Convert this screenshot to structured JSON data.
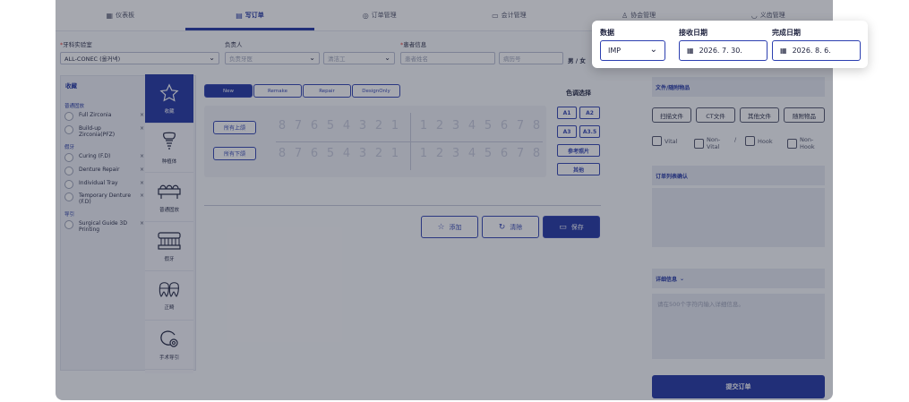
{
  "nav": {
    "items": [
      {
        "icon": "dashboard-icon",
        "label": "仪表板",
        "active": false
      },
      {
        "icon": "order-form-icon",
        "label": "写订单",
        "active": true
      },
      {
        "icon": "order-management-icon",
        "label": "订单管理",
        "active": false
      },
      {
        "icon": "accounting-icon",
        "label": "会计管理",
        "active": false
      },
      {
        "icon": "member-icon",
        "label": "协会管理",
        "active": false
      },
      {
        "icon": "denture-icon",
        "label": "义齿管理",
        "active": false
      }
    ]
  },
  "form": {
    "lab_label": "牙科实验室",
    "lab_value": "ALL-CONEC (올커넥)",
    "owner_label": "负责人",
    "owner_placeholder": "负责牙医",
    "tech_placeholder": "清洁工",
    "patient_label": "患者信息",
    "patient_name_placeholder": "患者姓名",
    "record_placeholder": "病历号",
    "gender_text": "男 / 女"
  },
  "favorites": {
    "title": "收藏",
    "categories": [
      "普通固放",
      "假牙",
      "导引"
    ],
    "items": [
      {
        "label": "Full Zirconia",
        "remove": "×"
      },
      {
        "label": "Build-up Zirconia(PFZ)",
        "remove": "×"
      },
      {
        "label": "Curing (F.D)",
        "remove": "×"
      },
      {
        "label": "Denture Repair",
        "remove": "×"
      },
      {
        "label": "Individual Tray",
        "remove": "×"
      },
      {
        "label": "Temporary Denture (F.D)",
        "remove": "×"
      },
      {
        "label": "Surgical Guide 3D Printing",
        "remove": "×"
      }
    ]
  },
  "categories": [
    {
      "icon": "star-icon",
      "label": "收藏"
    },
    {
      "icon": "implant-icon",
      "label": "种植体"
    },
    {
      "icon": "crown-bridge-icon",
      "label": "普通固放"
    },
    {
      "icon": "denture-icon",
      "label": "假牙"
    },
    {
      "icon": "ortho-icon",
      "label": "正畸"
    },
    {
      "icon": "surgical-guide-icon",
      "label": "手术导引"
    }
  ],
  "order_types": [
    "New",
    "Remake",
    "Repair",
    "DesignOnly"
  ],
  "teeth": {
    "upper_button": "所有上颌",
    "lower_button": "所有下颌",
    "left_numbers": [
      "8",
      "7",
      "6",
      "5",
      "4",
      "3",
      "2",
      "1"
    ],
    "right_numbers": [
      "1",
      "2",
      "3",
      "4",
      "5",
      "6",
      "7",
      "8"
    ]
  },
  "shade": {
    "title": "色调选择",
    "buttons": [
      "A1",
      "A2",
      "A3",
      "A3.5"
    ],
    "reference_photo": "参考照片",
    "other": "其他"
  },
  "actions": {
    "add": "添加",
    "clear": "清除",
    "save": "保存"
  },
  "right_panel": {
    "files_header": "文件/随附物品",
    "file_buttons": [
      "扫描文件",
      "CT文件",
      "其他文件",
      "随附物品"
    ],
    "checks": [
      "Vital",
      "Non-Vital",
      "Hook",
      "Non-Hook"
    ],
    "separator": "/",
    "order_list_header": "订单列表确认",
    "detail_header": "详细信息",
    "detail_placeholder": "请在500个字符内输入详细信息。",
    "submit": "提交订单"
  },
  "popup": {
    "data_label": "数据",
    "data_value": "IMP",
    "receive_label": "接收日期",
    "receive_value": "2026. 7. 30.",
    "complete_label": "完成日期",
    "complete_value": "2026. 8. 6."
  }
}
